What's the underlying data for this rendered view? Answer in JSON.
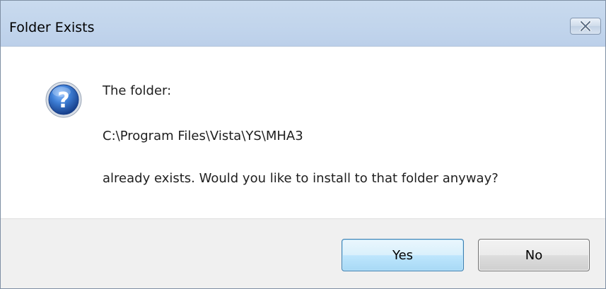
{
  "window": {
    "title": "Folder Exists",
    "close_icon": "close-x-icon"
  },
  "message": {
    "icon": "question-icon",
    "line1": "The folder:",
    "path": "C:\\Program Files\\Vista\\YS\\MHA3",
    "line3": "already exists. Would you like to install to that folder anyway?"
  },
  "buttons": {
    "yes_label": "Yes",
    "no_label": "No"
  },
  "colors": {
    "titlebar": "#c2d5ec",
    "footer": "#f0f0f0",
    "default_button_border": "#3c7fb1",
    "icon_blue": "#2a5fb0"
  }
}
